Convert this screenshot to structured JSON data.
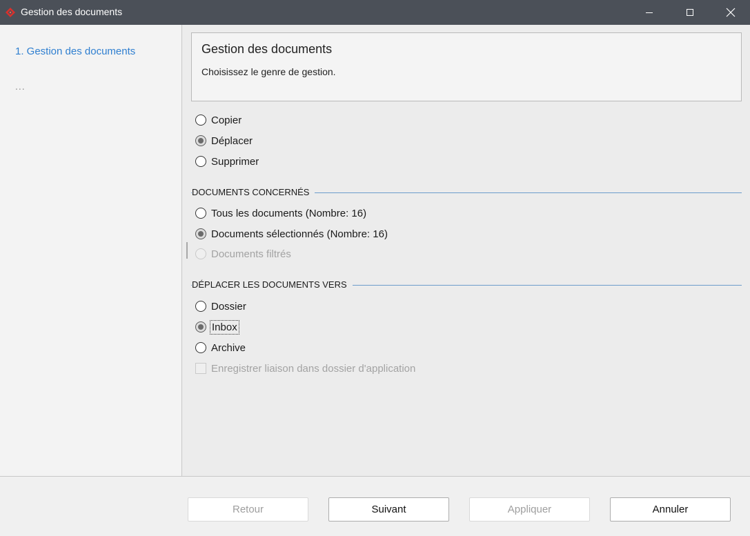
{
  "window": {
    "title": "Gestion des documents",
    "icon": "app-diamond-icon",
    "accent_color": "#d9302c"
  },
  "sidebar": {
    "steps": [
      {
        "label": "1. Gestion des documents",
        "active": true
      },
      {
        "label": "..."
      }
    ],
    "active_color": "#2f7fd0"
  },
  "header": {
    "title": "Gestion des documents",
    "subtitle": "Choisissez le genre de gestion."
  },
  "operation": {
    "options": [
      {
        "label": "Copier",
        "checked": false
      },
      {
        "label": "Déplacer",
        "checked": true
      },
      {
        "label": "Supprimer",
        "checked": false
      }
    ]
  },
  "documents": {
    "heading": "DOCUMENTS CONCERNÉS",
    "options": [
      {
        "label": "Tous les documents (Nombre: 16)",
        "checked": false
      },
      {
        "label": "Documents sélectionnés (Nombre: 16)",
        "checked": true
      },
      {
        "label": "Documents filtrés",
        "checked": false,
        "disabled": true
      }
    ]
  },
  "destination": {
    "heading": "DÉPLACER LES DOCUMENTS VERS",
    "options": [
      {
        "label": "Dossier",
        "checked": false
      },
      {
        "label": "Inbox",
        "checked": true,
        "focused": true
      },
      {
        "label": "Archive",
        "checked": false
      }
    ],
    "link_checkbox": {
      "label": "Enregistrer liaison dans dossier d'application",
      "checked": false,
      "disabled": true
    }
  },
  "footer": {
    "buttons": {
      "back": {
        "label": "Retour",
        "disabled": true
      },
      "next": {
        "label": "Suivant",
        "disabled": false
      },
      "apply": {
        "label": "Appliquer",
        "disabled": true
      },
      "cancel": {
        "label": "Annuler",
        "disabled": false
      }
    }
  }
}
